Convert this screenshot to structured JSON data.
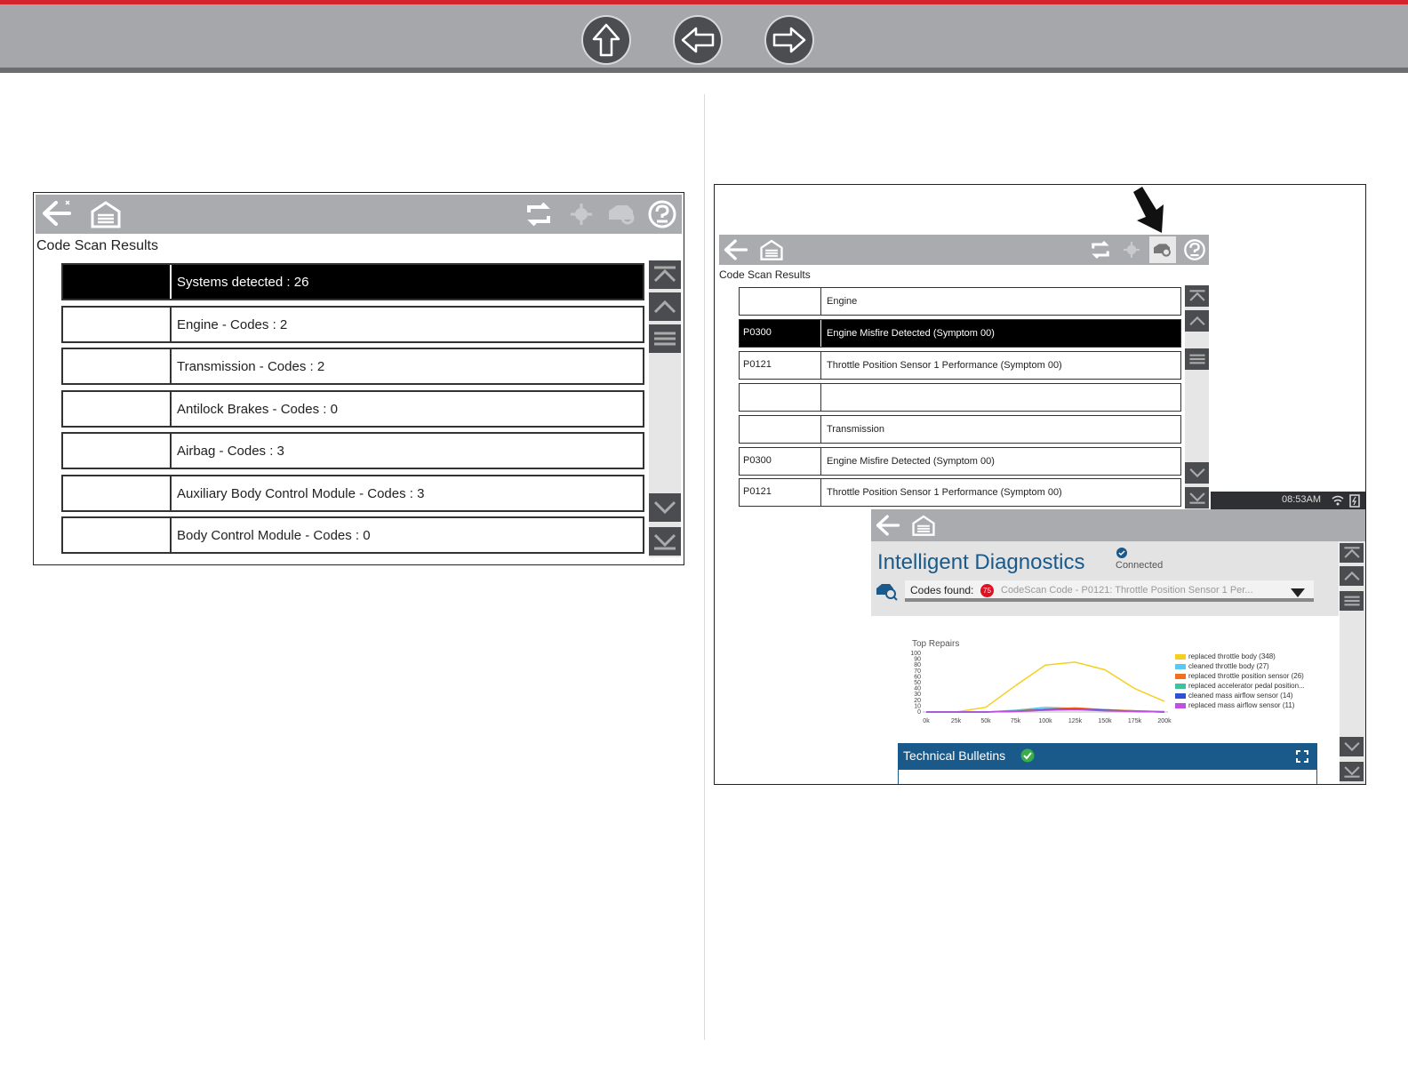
{
  "nav": {
    "home": "up-arrow-icon",
    "back": "left-arrow-icon",
    "forward": "right-arrow-icon"
  },
  "left_panel": {
    "title": "Code Scan Results",
    "rows": [
      {
        "label": "Systems detected : 26",
        "selected": true
      },
      {
        "label": "Engine - Codes : 2"
      },
      {
        "label": "Transmission - Codes : 2"
      },
      {
        "label": "Antilock Brakes - Codes : 0"
      },
      {
        "label": "Airbag - Codes : 3"
      },
      {
        "label": "Auxiliary Body Control Module - Codes : 3"
      },
      {
        "label": "Body Control Module - Codes : 0"
      }
    ]
  },
  "right_panel": {
    "title": "Code Scan Results",
    "rows": [
      {
        "code": "",
        "desc": "Engine"
      },
      {
        "code": "P0300",
        "desc": "Engine Misfire Detected (Symptom 00)",
        "selected": true
      },
      {
        "code": "P0121",
        "desc": "Throttle Position Sensor 1 Performance (Symptom 00)"
      },
      {
        "code": "",
        "desc": ""
      },
      {
        "code": "",
        "desc": "Transmission"
      },
      {
        "code": "P0300",
        "desc": "Engine Misfire Detected (Symptom 00)"
      },
      {
        "code": "P0121",
        "desc": "Throttle Position Sensor 1 Performance (Symptom 00)"
      }
    ],
    "status_time": "08:53AM",
    "id": {
      "title": "Intelligent Diagnostics",
      "connected": "Connected",
      "codes_found_label": "Codes found:",
      "codes_count": "75",
      "dropdown_text": "CodeScan Code - P0121: Throttle Position Sensor 1 Per...",
      "bulletins": "Technical Bulletins"
    }
  },
  "chart_data": {
    "type": "line",
    "title": "Top Repairs",
    "x": [
      "0k",
      "25k",
      "50k",
      "75k",
      "100k",
      "125k",
      "150k",
      "175k",
      "200k"
    ],
    "ylim": [
      0,
      100
    ],
    "yticks": [
      "100",
      "90",
      "80",
      "70",
      "60",
      "50",
      "40",
      "30",
      "20",
      "10",
      "0"
    ],
    "series": [
      {
        "name": "replaced throttle body (348)",
        "color": "#f5d020",
        "values": [
          0,
          0,
          8,
          45,
          80,
          85,
          72,
          40,
          18
        ]
      },
      {
        "name": "cleaned throttle body (27)",
        "color": "#5bc8f0",
        "values": [
          0,
          0,
          0,
          3,
          8,
          6,
          4,
          2,
          1
        ]
      },
      {
        "name": "replaced throttle position sensor (26)",
        "color": "#f07020",
        "values": [
          0,
          0,
          0,
          2,
          5,
          7,
          4,
          2,
          0
        ]
      },
      {
        "name": "replaced accelerator pedal position...",
        "color": "#40c0a0",
        "values": [
          0,
          0,
          0,
          2,
          3,
          4,
          3,
          1,
          0
        ]
      },
      {
        "name": "cleaned mass airflow sensor (14)",
        "color": "#3050d0",
        "values": [
          0,
          0,
          0,
          1,
          4,
          5,
          3,
          1,
          0
        ]
      },
      {
        "name": "replaced mass airflow sensor (11)",
        "color": "#c050e0",
        "values": [
          0,
          0,
          0,
          1,
          3,
          4,
          2,
          1,
          0
        ]
      }
    ]
  }
}
